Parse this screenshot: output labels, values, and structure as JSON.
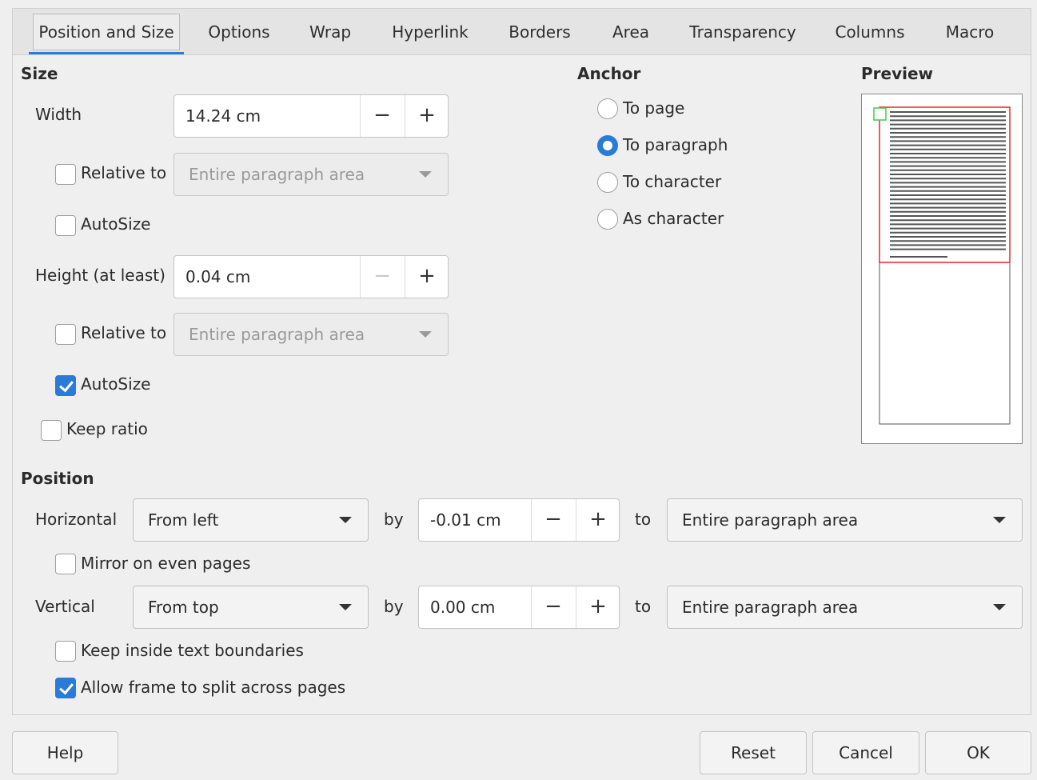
{
  "tabs": [
    "Position and Size",
    "Options",
    "Wrap",
    "Hyperlink",
    "Borders",
    "Area",
    "Transparency",
    "Columns",
    "Macro"
  ],
  "size": {
    "heading": "Size",
    "width_label": "Width",
    "width_value": "14.24 cm",
    "width_relative_label": "Relative to",
    "width_relative_value": "Entire paragraph area",
    "width_autosize_label": "AutoSize",
    "height_label": "Height (at least)",
    "height_value": "0.04 cm",
    "height_relative_label": "Relative to",
    "height_relative_value": "Entire paragraph area",
    "height_autosize_label": "AutoSize",
    "keep_ratio_label": "Keep ratio",
    "minus": "−",
    "plus": "+"
  },
  "anchor": {
    "heading": "Anchor",
    "options": [
      "To page",
      "To paragraph",
      "To character",
      "As character"
    ],
    "selected": "To paragraph"
  },
  "preview": {
    "heading": "Preview"
  },
  "position": {
    "heading": "Position",
    "horizontal_label": "Horizontal",
    "horizontal_value": "From left",
    "by_label": "by",
    "horizontal_by": "-0.01 cm",
    "to_label": "to",
    "horizontal_to": "Entire paragraph area",
    "mirror_label": "Mirror on even pages",
    "vertical_label": "Vertical",
    "vertical_value": "From top",
    "vertical_by": "0.00 cm",
    "vertical_to": "Entire paragraph area",
    "keep_inside_label": "Keep inside text boundaries",
    "allow_split_label": "Allow frame to split across pages"
  },
  "buttons": {
    "help": "Help",
    "reset": "Reset",
    "cancel": "Cancel",
    "ok": "OK"
  },
  "colors": {
    "accent": "#2a7bd8",
    "preview_frame": "#e0282e",
    "preview_anchor": "#3fd03f"
  },
  "states": {
    "width_relative_checked": false,
    "width_autosize_checked": false,
    "height_relative_checked": false,
    "height_autosize_checked": true,
    "keep_ratio_checked": false,
    "mirror_checked": false,
    "keep_inside_checked": false,
    "allow_split_checked": true
  }
}
